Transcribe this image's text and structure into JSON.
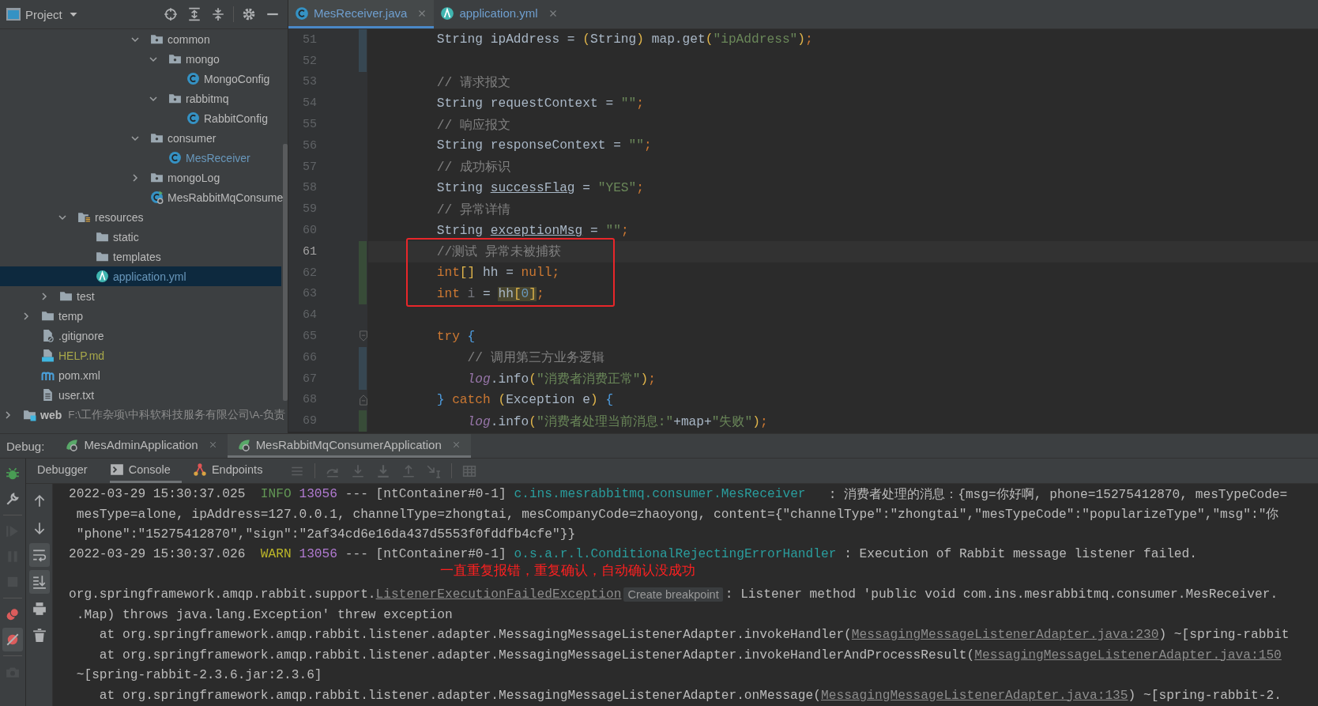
{
  "project_panel": {
    "title": "Project",
    "tree": [
      {
        "children": [
          {
            "children": [
              {
                "children": [
                  {
                    "children": [
                      {
                        "children": [
                          {
                            "children": [
                              {
                                "children": [
                                  {
                                    "label": "common",
                                    "kind": "package",
                                    "expanded": true,
                                    "selected": false,
                                    "color": "#bbbbbb",
                                    "children": [
                                      {
                                        "label": "mongo",
                                        "kind": "package",
                                        "expanded": true,
                                        "selected": false,
                                        "color": "#bbbbbb",
                                        "children": [
                                          {
                                            "label": "MongoConfig",
                                            "kind": "class",
                                            "selected": false,
                                            "color": "#bbbbbb"
                                          }
                                        ]
                                      },
                                      {
                                        "label": "rabbitmq",
                                        "kind": "package",
                                        "expanded": true,
                                        "selected": false,
                                        "color": "#bbbbbb",
                                        "children": [
                                          {
                                            "label": "RabbitConfig",
                                            "kind": "class",
                                            "selected": false,
                                            "color": "#bbbbbb"
                                          }
                                        ]
                                      }
                                    ]
                                  },
                                  {
                                    "label": "consumer",
                                    "kind": "package",
                                    "expanded": true,
                                    "selected": false,
                                    "color": "#bbbbbb",
                                    "children": [
                                      {
                                        "label": "MesReceiver",
                                        "kind": "class",
                                        "selected": false,
                                        "color": "#6897bb"
                                      }
                                    ]
                                  },
                                  {
                                    "label": "mongoLog",
                                    "kind": "package",
                                    "expanded": false,
                                    "selected": false,
                                    "color": "#bbbbbb"
                                  },
                                  {
                                    "label": "MesRabbitMqConsume",
                                    "kind": "app",
                                    "selected": false,
                                    "color": "#bbbbbb"
                                  }
                                ]
                              }
                            ]
                          }
                        ]
                      }
                    ]
                  },
                  {
                    "label": "resources",
                    "kind": "resources",
                    "expanded": true,
                    "selected": false,
                    "color": "#bbbbbb",
                    "children": [
                      {
                        "label": "static",
                        "kind": "folder",
                        "selected": false,
                        "color": "#bbbbbb"
                      },
                      {
                        "label": "templates",
                        "kind": "folder",
                        "selected": false,
                        "color": "#bbbbbb"
                      },
                      {
                        "label": "application.yml",
                        "kind": "yml",
                        "selected": true,
                        "color": "#6897bb"
                      }
                    ]
                  }
                ]
              },
              {
                "label": "test",
                "kind": "folder",
                "expanded": false,
                "selected": false,
                "color": "#bbbbbb"
              }
            ]
          },
          {
            "label": "temp",
            "kind": "folder",
            "expanded": false,
            "selected": false,
            "color": "#bbbbbb"
          },
          {
            "label": ".gitignore",
            "kind": "ignore",
            "selected": false,
            "color": "#bbbbbb"
          },
          {
            "label": "HELP.md",
            "kind": "md",
            "selected": false,
            "color": "#a8a84a"
          },
          {
            "label": "pom.xml",
            "kind": "maven",
            "selected": false,
            "color": "#bbbbbb"
          },
          {
            "label": "user.txt",
            "kind": "text",
            "selected": false,
            "color": "#bbbbbb"
          }
        ]
      },
      {
        "label": "web",
        "kind": "module",
        "expanded": false,
        "selected": false,
        "color": "#bbbbbb",
        "path": "F:\\工作杂项\\中科软科技服务有限公司\\A-负责"
      }
    ]
  },
  "editor": {
    "tabs": [
      {
        "label": "MesReceiver.java",
        "kind": "class",
        "selected": true
      },
      {
        "label": "application.yml",
        "kind": "yml",
        "selected": false
      }
    ],
    "lines": [
      {
        "number": "51",
        "added": false,
        "modified": true,
        "fold_start": false,
        "fold_end": false,
        "current": false,
        "boxed": false,
        "nested": false,
        "tokens": [
          {
            "kind": "plain",
            "text": "String ipAddress = "
          },
          {
            "kind": "bracket",
            "text": "("
          },
          {
            "kind": "plain",
            "text": "String"
          },
          {
            "kind": "bracket",
            "text": ")"
          },
          {
            "kind": "plain",
            "text": " map.get"
          },
          {
            "kind": "bracket",
            "text": "("
          },
          {
            "kind": "string",
            "text": "\"ipAddress\""
          },
          {
            "kind": "bracket",
            "text": ")"
          },
          {
            "kind": "keyword",
            "text": ";"
          }
        ]
      },
      {
        "number": "52",
        "added": false,
        "modified": true,
        "fold_start": false,
        "fold_end": false,
        "current": false,
        "boxed": false
      },
      {
        "number": "53",
        "added": false,
        "modified": false,
        "fold_start": false,
        "fold_end": false,
        "current": false,
        "boxed": false,
        "nested": false,
        "tokens": [
          {
            "kind": "comment",
            "text": "// 请求报文"
          }
        ]
      },
      {
        "number": "54",
        "added": false,
        "modified": false,
        "fold_start": false,
        "fold_end": false,
        "current": false,
        "boxed": false,
        "nested": false,
        "tokens": [
          {
            "kind": "plain",
            "text": "String requestContext = "
          },
          {
            "kind": "string",
            "text": "\"\""
          },
          {
            "kind": "keyword",
            "text": ";"
          }
        ]
      },
      {
        "number": "55",
        "added": false,
        "modified": false,
        "fold_start": false,
        "fold_end": false,
        "current": false,
        "boxed": false,
        "nested": false,
        "tokens": [
          {
            "kind": "comment",
            "text": "// 响应报文"
          }
        ]
      },
      {
        "number": "56",
        "added": false,
        "modified": false,
        "fold_start": false,
        "fold_end": false,
        "current": false,
        "boxed": false,
        "nested": false,
        "tokens": [
          {
            "kind": "plain",
            "text": "String responseContext = "
          },
          {
            "kind": "string",
            "text": "\"\""
          },
          {
            "kind": "keyword",
            "text": ";"
          }
        ]
      },
      {
        "number": "57",
        "added": false,
        "modified": false,
        "fold_start": false,
        "fold_end": false,
        "current": false,
        "boxed": false,
        "nested": false,
        "tokens": [
          {
            "kind": "comment",
            "text": "// 成功标识"
          }
        ]
      },
      {
        "number": "58",
        "added": false,
        "modified": false,
        "fold_start": false,
        "fold_end": false,
        "current": false,
        "boxed": false,
        "nested": false,
        "tokens": [
          {
            "kind": "plain",
            "text": "String "
          },
          {
            "kind": "underlined",
            "text": "successFlag"
          },
          {
            "kind": "plain",
            "text": " = "
          },
          {
            "kind": "string",
            "text": "\"YES\""
          },
          {
            "kind": "keyword",
            "text": ";"
          }
        ]
      },
      {
        "number": "59",
        "added": false,
        "modified": false,
        "fold_start": false,
        "fold_end": false,
        "current": false,
        "boxed": false,
        "nested": false,
        "tokens": [
          {
            "kind": "comment",
            "text": "// 异常详情"
          }
        ]
      },
      {
        "number": "60",
        "added": false,
        "modified": false,
        "fold_start": false,
        "fold_end": false,
        "current": false,
        "boxed": false,
        "nested": false,
        "tokens": [
          {
            "kind": "plain",
            "text": "String "
          },
          {
            "kind": "underlined",
            "text": "exceptionMsg"
          },
          {
            "kind": "plain",
            "text": " = "
          },
          {
            "kind": "string",
            "text": "\"\""
          },
          {
            "kind": "keyword",
            "text": ";"
          }
        ]
      },
      {
        "number": "61",
        "added": true,
        "modified": false,
        "fold_start": false,
        "fold_end": false,
        "current": true,
        "boxed": true,
        "nested": false,
        "tokens": [
          {
            "kind": "comment",
            "text": "//测试 异常未被捕获"
          }
        ]
      },
      {
        "number": "62",
        "added": true,
        "modified": false,
        "fold_start": false,
        "fold_end": false,
        "current": false,
        "boxed": true,
        "nested": false,
        "tokens": [
          {
            "kind": "keyword",
            "text": "int"
          },
          {
            "kind": "bracket",
            "text": "[]"
          },
          {
            "kind": "plain",
            "text": " hh = "
          },
          {
            "kind": "keyword",
            "text": "null;"
          }
        ]
      },
      {
        "number": "63",
        "added": true,
        "modified": false,
        "fold_start": false,
        "fold_end": false,
        "current": false,
        "boxed": true,
        "nested": false,
        "tokens": [
          {
            "kind": "keyword",
            "text": "int "
          },
          {
            "kind": "unused",
            "text": "i"
          },
          {
            "kind": "plain",
            "text": " = "
          },
          {
            "kind": "match-plain",
            "text": "hh"
          },
          {
            "kind": "match-bracket",
            "text": "["
          },
          {
            "kind": "match-number",
            "text": "0"
          },
          {
            "kind": "match-bracket",
            "text": "]"
          },
          {
            "kind": "keyword",
            "text": ";"
          }
        ]
      },
      {
        "number": "64",
        "added": false,
        "modified": false,
        "fold_start": false,
        "fold_end": false,
        "current": false,
        "boxed": false
      },
      {
        "number": "65",
        "added": false,
        "modified": false,
        "fold_start": true,
        "fold_end": false,
        "current": false,
        "boxed": false,
        "nested": false,
        "tokens": [
          {
            "kind": "keyword",
            "text": "try "
          },
          {
            "kind": "brace",
            "text": "{"
          }
        ]
      },
      {
        "number": "66",
        "added": false,
        "modified": true,
        "fold_start": false,
        "fold_end": false,
        "current": false,
        "boxed": false,
        "nested": true,
        "tokens": [
          {
            "kind": "comment",
            "text": "// 调用第三方业务逻辑"
          }
        ]
      },
      {
        "number": "67",
        "added": false,
        "modified": true,
        "fold_start": false,
        "fold_end": false,
        "current": false,
        "boxed": false,
        "nested": true,
        "tokens": [
          {
            "kind": "static",
            "text": "log"
          },
          {
            "kind": "plain",
            "text": ".info"
          },
          {
            "kind": "bracket",
            "text": "("
          },
          {
            "kind": "string",
            "text": "\"消费者消费正常\""
          },
          {
            "kind": "bracket",
            "text": ")"
          },
          {
            "kind": "keyword",
            "text": ";"
          }
        ]
      },
      {
        "number": "68",
        "added": false,
        "modified": false,
        "fold_start": false,
        "fold_end": true,
        "current": false,
        "boxed": false,
        "nested": false,
        "tokens": [
          {
            "kind": "brace",
            "text": "} "
          },
          {
            "kind": "keyword",
            "text": "catch "
          },
          {
            "kind": "bracket",
            "text": "("
          },
          {
            "kind": "plain",
            "text": "Exception e"
          },
          {
            "kind": "bracket",
            "text": ") "
          },
          {
            "kind": "brace",
            "text": "{"
          }
        ]
      },
      {
        "number": "69",
        "added": true,
        "modified": false,
        "fold_start": false,
        "fold_end": false,
        "current": false,
        "boxed": false,
        "nested": true,
        "tokens": [
          {
            "kind": "static",
            "text": "log"
          },
          {
            "kind": "plain",
            "text": ".info"
          },
          {
            "kind": "bracket",
            "text": "("
          },
          {
            "kind": "string",
            "text": "\"消费者处理当前消息:\""
          },
          {
            "kind": "plain",
            "text": "+map+"
          },
          {
            "kind": "string",
            "text": "\"失败\""
          },
          {
            "kind": "bracket",
            "text": ")"
          },
          {
            "kind": "keyword",
            "text": ";"
          }
        ]
      }
    ]
  },
  "debug": {
    "title": "Debug:",
    "sessions": [
      {
        "label": "MesAdminApplication",
        "selected": false
      },
      {
        "label": "MesRabbitMqConsumerApplication",
        "selected": true
      }
    ],
    "views": [
      {
        "label": "Debugger",
        "kind": "debugger",
        "selected": false
      },
      {
        "label": "Console",
        "kind": "console",
        "selected": true
      },
      {
        "label": "Endpoints",
        "kind": "endpoints",
        "selected": false
      }
    ],
    "actions": [
      {
        "kind": "menu",
        "disabled": true
      },
      {
        "kind": "step-over",
        "disabled": true
      },
      {
        "kind": "step-into",
        "disabled": true
      },
      {
        "kind": "force-step-into",
        "disabled": true
      },
      {
        "kind": "step-out",
        "disabled": true
      },
      {
        "kind": "run-to-cursor",
        "disabled": true
      },
      {
        "kind": "table",
        "disabled": true
      }
    ],
    "side_actions": [
      {
        "kind": "bug",
        "disabled": false,
        "on": false
      },
      {
        "kind": "wrench",
        "disabled": false,
        "on": false
      },
      {
        "kind": "resume",
        "disabled": true,
        "on": false
      },
      {
        "kind": "pause",
        "disabled": true,
        "on": false
      },
      {
        "kind": "stop",
        "disabled": true,
        "on": false
      },
      {
        "kind": "breakpoints",
        "disabled": false,
        "on": false
      },
      {
        "kind": "mute",
        "disabled": false,
        "on": true
      },
      {
        "kind": "camera",
        "disabled": true,
        "on": false
      }
    ],
    "console_actions": [
      {
        "kind": "arrow-up",
        "on": false
      },
      {
        "kind": "arrow-down",
        "on": false
      },
      {
        "kind": "wrap",
        "on": true
      },
      {
        "kind": "scroll-end",
        "on": true
      },
      {
        "kind": "print",
        "on": false
      },
      {
        "kind": "trash",
        "on": false
      }
    ],
    "console": {
      "lines": [
        {
          "kind": "text",
          "segments": [
            {
              "kind": "plain",
              "text": "2022-03-29 15:30:37.025  "
            },
            {
              "kind": "info",
              "text": "INFO"
            },
            {
              "kind": "pid",
              "text": " 13056"
            },
            {
              "kind": "plain",
              "text": " --- [ntContainer#0-1] "
            },
            {
              "kind": "logger",
              "text": "c.ins.mesrabbitmq.consumer.MesReceiver"
            },
            {
              "kind": "plain",
              "text": "   : 消费者处理的消息：{msg=你好啊, phone=15275412870, mesTypeCode="
            }
          ]
        },
        {
          "kind": "text",
          "segments": [
            {
              "kind": "plain",
              "text": " mesType=alone, ipAddress=127.0.0.1, channelType=zhongtai, mesCompanyCode=zhaoyong, content={\"channelType\":\"zhongtai\",\"mesTypeCode\":\"popularizeType\",\"msg\":\"你"
            }
          ]
        },
        {
          "kind": "text",
          "segments": [
            {
              "kind": "plain",
              "text": " \"phone\":\"15275412870\",\"sign\":\"2af34cd6e16da437d5553f0fddfb4cfe\"}}"
            }
          ]
        },
        {
          "kind": "text",
          "segments": [
            {
              "kind": "plain",
              "text": "2022-03-29 15:30:37.026  "
            },
            {
              "kind": "warn",
              "text": "WARN"
            },
            {
              "kind": "pid",
              "text": " 13056"
            },
            {
              "kind": "plain",
              "text": " --- [ntContainer#0-1] "
            },
            {
              "kind": "logger",
              "text": "o.s.a.r.l.ConditionalRejectingErrorHandler"
            },
            {
              "kind": "plain",
              "text": " : Execution of Rabbit message listener failed."
            }
          ]
        },
        {
          "kind": "blank",
          "annotation": "一直重复报错，重复确认，自动确认没成功"
        },
        {
          "kind": "text",
          "segments": [
            {
              "kind": "plain",
              "text": "org.springframework.amqp.rabbit.support."
            },
            {
              "kind": "link",
              "text": "ListenerExecutionFailedException"
            },
            {
              "kind": "tooltip",
              "text": "Create breakpoint"
            },
            {
              "kind": "plain",
              "text": ": Listener method 'public void com.ins.mesrabbitmq.consumer.MesReceiver."
            }
          ]
        },
        {
          "kind": "text",
          "segments": [
            {
              "kind": "plain",
              "text": " .Map) throws java.lang.Exception' threw exception"
            }
          ]
        },
        {
          "kind": "text",
          "segments": [
            {
              "kind": "plain",
              "text": "    at org.springframework.amqp.rabbit.listener.adapter.MessagingMessageListenerAdapter.invokeHandler("
            },
            {
              "kind": "link",
              "text": "MessagingMessageListenerAdapter.java:230"
            },
            {
              "kind": "plain",
              "text": ") ~[spring-rabbit"
            }
          ]
        },
        {
          "kind": "text",
          "segments": [
            {
              "kind": "plain",
              "text": "    at org.springframework.amqp.rabbit.listener.adapter.MessagingMessageListenerAdapter.invokeHandlerAndProcessResult("
            },
            {
              "kind": "link",
              "text": "MessagingMessageListenerAdapter.java:150"
            }
          ]
        },
        {
          "kind": "text",
          "segments": [
            {
              "kind": "plain",
              "text": " ~[spring-rabbit-2.3.6.jar:2.3.6]"
            }
          ]
        },
        {
          "kind": "text",
          "segments": [
            {
              "kind": "plain",
              "text": "    at org.springframework.amqp.rabbit.listener.adapter.MessagingMessageListenerAdapter.onMessage("
            },
            {
              "kind": "link",
              "text": "MessagingMessageListenerAdapter.java:135"
            },
            {
              "kind": "plain",
              "text": ") ~[spring-rabbit-2."
            }
          ]
        }
      ]
    }
  }
}
